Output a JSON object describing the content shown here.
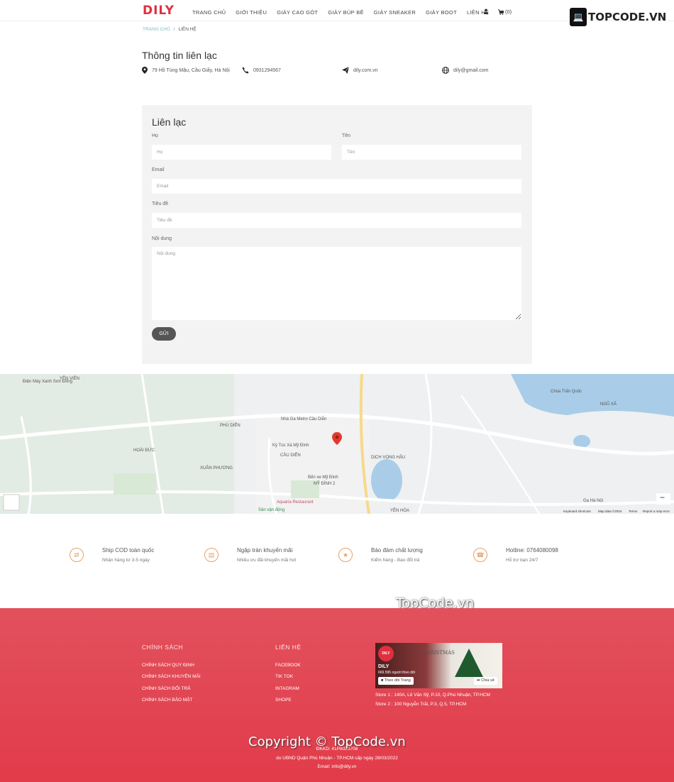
{
  "header": {
    "logo": "DILY",
    "nav": [
      "TRANG CHỦ",
      "GIỚI THIỆU",
      "GIÀY CAO GÓT",
      "GIÀY BÚP BÊ",
      "GIÀY SNEAKER",
      "GIÀY BOOT",
      "LIÊN HỆ"
    ],
    "cart_count": "(0)",
    "badge_text": "TOPCODE.VN"
  },
  "breadcrumb": {
    "home": "TRANG CHỦ",
    "sep": "/",
    "current": "LIÊN HỆ"
  },
  "contact_info": {
    "title": "Thông tin liên lạc",
    "address": "79 Hồ Tùng Mậu, Cầu Giấy, Hà Nội",
    "phone": "0931294567",
    "website": "dily.com.vn",
    "email": "dily@gmail.com"
  },
  "form": {
    "title": "Liên lạc",
    "last_name_label": "Họ",
    "last_name_placeholder": "Họ",
    "first_name_label": "Tên",
    "first_name_placeholder": "Tên",
    "email_label": "Email",
    "email_placeholder": "Email",
    "subject_label": "Tiêu đề",
    "subject_placeholder": "Tiêu đề",
    "message_label": "Nội dung",
    "message_placeholder": "Nội dung",
    "submit": "GỬI"
  },
  "map": {
    "labels": [
      "Nhà Ga Metro Cầu Diễn",
      "Ký Túc Xá Mỹ Đình",
      "Bến xe Mỹ Đình",
      "DỊCH VỌNG HẬU",
      "Aquaria Restaurant",
      "CẦU DIỄN",
      "YÊN HÒA",
      "Điện Máy Xanh Sơn Đồng",
      "YÊN VIÊN",
      "XUÂN PHƯƠNG",
      "Chùa Trấn Quốc",
      "Ga Hà Nội",
      "PHÚ DIỄN",
      "HOÀI ĐỨC",
      "MỸ ĐÌNH 2",
      "Sân vận động",
      "NGŨ XÃ"
    ],
    "zoom_minus": "−",
    "footer_links": [
      "Keyboard shortcuts",
      "Map data ©2024",
      "Terms",
      "Report a map error"
    ]
  },
  "features": [
    {
      "title": "Ship COD toàn quốc",
      "subtitle": "Nhận hàng từ 3-5 ngày"
    },
    {
      "title": "Ngập tràn khuyến mãi",
      "subtitle": "Nhiều ưu đãi khuyến mãi hot"
    },
    {
      "title": "Bảo đảm chất lượng",
      "subtitle": "Kiểm hàng - Bao đổi trả"
    },
    {
      "title": "Hotline: 0764080098",
      "subtitle": "Hỗ trợ bạn 24/7"
    }
  ],
  "watermark_mid": "TopCode.vn",
  "footer": {
    "policy_title": "CHÍNH SÁCH",
    "policy_links": [
      "CHÍNH SÁCH QUY ĐỊNH",
      "CHÍNH SÁCH KHUYẾN MÃI",
      "CHÍNH SÁCH ĐỔI TRẢ",
      "CHÍNH SÁCH BẢO MẬT"
    ],
    "contact_title": "LIÊN HỆ",
    "contact_links": [
      "FACEBOOK",
      "TIK TOK",
      "INTAGRAM",
      "SHOPE"
    ],
    "fb_name": "DILY",
    "fb_followers": "669.595 người theo dõi",
    "fb_follow": "Theo dõi Trang",
    "fb_share": "Chia sẻ",
    "fb_banner": "CHRISTMAS",
    "store1": "Store 1 : 140A, Lê Văn Sỹ, P.10, Q.Phú Nhuận, TP.HCM",
    "store2": "Store 2 : 100 Nguyễn Trãi, P.3, Q.5, TP.HCM",
    "bottom1": "ĐKKD: 41P8023708",
    "bottom2": "do UBND Quận Phú Nhuận - TP.HCM cấp ngày 28/03/2022",
    "bottom3": "Email: info@dily.vn",
    "copyright": "Copyright © TopCode.vn"
  },
  "colors": {
    "brand": "#e0303f",
    "footer": "#e2474f",
    "accent": "#e8a26a"
  }
}
